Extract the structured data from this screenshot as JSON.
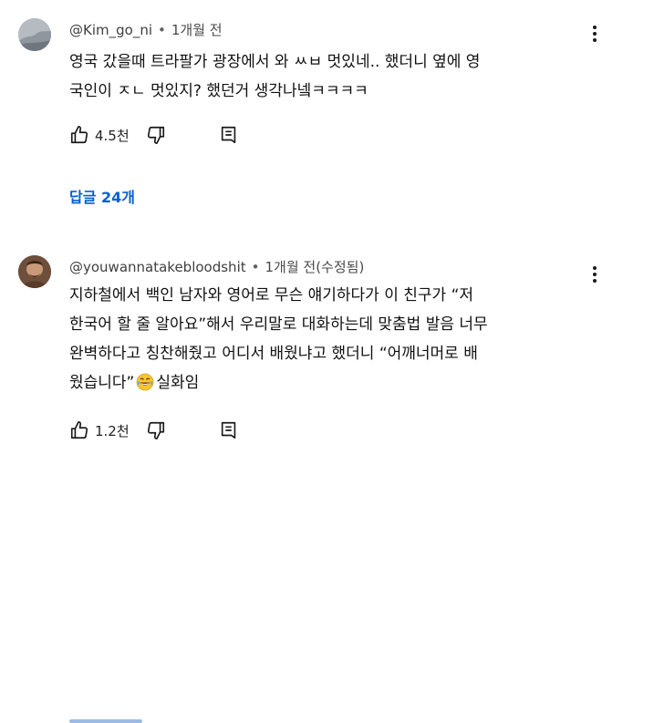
{
  "comments": [
    {
      "author": "@Kim_go_ni",
      "time": "1개월 전",
      "edited": "",
      "lines": [
        "영국 갔을때 트라팔가 광장에서 와 ㅆㅂ 멋있네.. 했더니 옆에 영",
        "국인이 ㅈㄴ 멋있지? 했던거 생각나넼ㅋㅋㅋㅋ"
      ],
      "likes": "4.5천",
      "replies": "답글 24개",
      "avatar_icon": "default-avatar-icon"
    },
    {
      "author": "@youwannatakebloodshit",
      "time": "1개월 전",
      "edited": "(수정됨)",
      "lines": [
        "지하철에서 백인 남자와 영어로 무슨 얘기하다가 이 친구가 “저",
        "한국어 할 줄 알아요”해서 우리말로 대화하는데 맞춤법 발음 너무",
        "완벽하다고 칭찬해줬고 어디서 배웠냐고 했더니 “어깨너머로 배",
        "웠습니다”"
      ],
      "last_line_suffix": "실화임",
      "likes": "1.2천",
      "avatar_icon": "profile-photo-avatar",
      "emoji_icon": "laughing-tears-emoji-icon"
    }
  ],
  "colors": {
    "link": "#065fd4",
    "meta": "#606060",
    "text": "#0f0f0f"
  }
}
